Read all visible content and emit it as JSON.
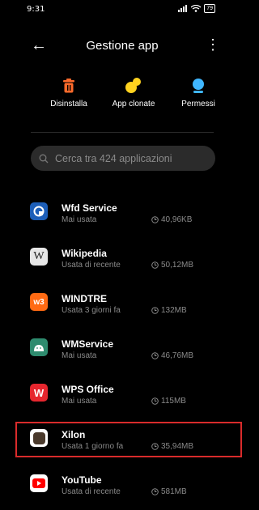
{
  "status": {
    "time": "9:31",
    "battery": "79"
  },
  "header": {
    "title": "Gestione app"
  },
  "actions": [
    {
      "label": "Disinstalla",
      "icon": "trash-icon",
      "color": "#ff6a2b"
    },
    {
      "label": "App clonate",
      "icon": "clone-icon",
      "color": "#ffd21f"
    },
    {
      "label": "Permessi",
      "icon": "shield-person-icon",
      "color": "#3fb6ff"
    }
  ],
  "search": {
    "placeholder": "Cerca tra 424 applicazioni"
  },
  "apps": [
    {
      "name": "Wfd Service",
      "status": "Mai usata",
      "size": "40,96KB",
      "icon": "wfd-service-icon"
    },
    {
      "name": "Wikipedia",
      "status": "Usata di recente",
      "size": "50,12MB",
      "icon": "wikipedia-icon"
    },
    {
      "name": "WINDTRE",
      "status": "Usata 3 giorni fa",
      "size": "132MB",
      "icon": "windtre-icon"
    },
    {
      "name": "WMService",
      "status": "Mai usata",
      "size": "46,76MB",
      "icon": "android-icon"
    },
    {
      "name": "WPS Office",
      "status": "Mai usata",
      "size": "115MB",
      "icon": "wps-office-icon"
    },
    {
      "name": "Xilon",
      "status": "Usata 1 giorno fa",
      "size": "35,94MB",
      "icon": "xilon-icon"
    },
    {
      "name": "YouTube",
      "status": "Usata di recente",
      "size": "581MB",
      "icon": "youtube-icon"
    }
  ]
}
